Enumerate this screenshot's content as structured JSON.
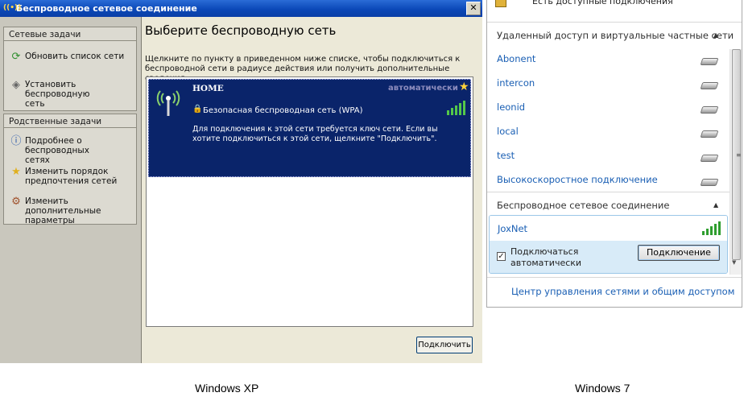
{
  "xp": {
    "window_title": "Беспроводное сетевое соединение",
    "close_glyph": "✕",
    "panels": {
      "network_tasks": {
        "title": "Сетевые задачи",
        "items": [
          {
            "icon": "refresh-icon",
            "label": "Обновить список сети"
          },
          {
            "icon": "setup-network-icon",
            "label": "Установить беспроводную\nсеть"
          }
        ]
      },
      "related_tasks": {
        "title": "Родственные задачи",
        "items": [
          {
            "icon": "info-icon",
            "label": "Подробнее о беспроводных\nсетях"
          },
          {
            "icon": "star-icon",
            "label": "Изменить порядок\nпредпочтения  сетей"
          },
          {
            "icon": "settings-icon",
            "label": "Изменить дополнительные\nпараметры"
          }
        ]
      }
    },
    "heading": "Выберите беспроводную сеть",
    "description": "Щелкните по пункту в приведенном ниже списке, чтобы подключиться к беспроводной сети в радиусе действия или получить дополнительные сведения.",
    "network": {
      "name": "HOME",
      "status": "автоматически",
      "security": "Безопасная беспроводная сеть (WPA)",
      "detail": "Для подключения к этой сети требуется ключ сети. Если вы хотите подключиться к этой сети, щелкните \"Подключить\".",
      "signal_bars": 5
    },
    "connect_button": "Подключить"
  },
  "w7": {
    "top_item_label": "Есть доступные подключения",
    "vpn_section_title": "Удаленный доступ и виртуальные частные сети",
    "vpn_connections": [
      "Abonent",
      "intercon",
      "leonid",
      "local",
      "test",
      "Высокоскоростное подключение"
    ],
    "wireless_section_title": "Беспроводное сетевое соединение",
    "network": {
      "name": "JoxNet",
      "signal_bars": 5,
      "auto_connect_label": "Подключаться автоматически",
      "auto_connect_checked": true,
      "connect_button": "Подключение"
    },
    "footer_link": "Центр управления сетями и общим доступом"
  },
  "captions": {
    "left": "Windows XP",
    "right": "Windows 7"
  },
  "colors": {
    "xp_titlebar": "#0b48b8",
    "xp_selected_item": "#0a246a",
    "w7_link": "#1a5fb4",
    "w7_hover": "#d8ebf8",
    "signal_green": "#54c84a"
  }
}
